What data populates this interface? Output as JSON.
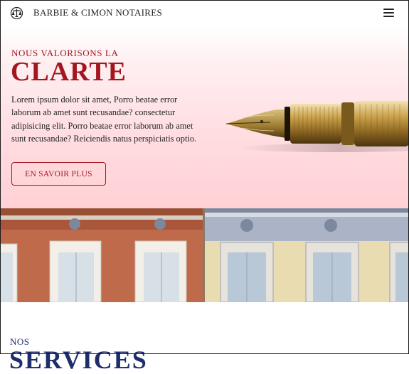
{
  "header": {
    "brand": "BARBIE & CIMON NOTAIRES",
    "logo_icon": "scales-logo-icon",
    "menu_icon": "hamburger-menu-icon"
  },
  "hero": {
    "eyebrow": "NOUS VALORISONS LA",
    "headline": "CLARTE",
    "body": "Lorem ipsum dolor sit amet, Porro beatae error laborum ab amet sunt recusandae? consectetur adipisicing elit. Porro beatae error laborum ab amet sunt recusandae? Reiciendis natus perspiciatis optio.",
    "cta_label": "EN SAVOIR PLUS",
    "image": "fountain-pen"
  },
  "building_image": "building-facade-photo",
  "services": {
    "eyebrow": "NOS",
    "title": "SERVICES"
  },
  "colors": {
    "accent": "#a3161f",
    "hero_bg": "#ffd9dd",
    "services": "#1f2d6b",
    "text": "#222222"
  }
}
